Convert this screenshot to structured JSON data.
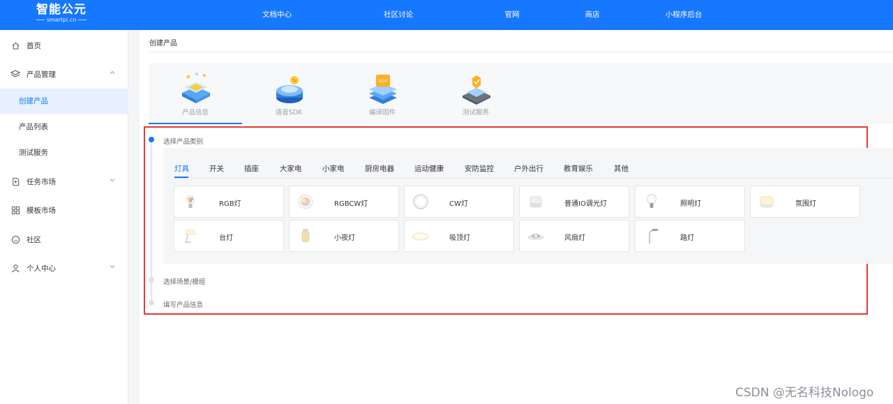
{
  "topbar": {
    "logo": {
      "brand": "智能公元",
      "domain": "smartpi.cn"
    },
    "nav": [
      "文档中心",
      "社区讨论",
      "官网",
      "商店",
      "小程序后台"
    ]
  },
  "sidebar": {
    "items": [
      {
        "label": "首页",
        "icon": "home-icon"
      },
      {
        "label": "产品管理",
        "icon": "layers-icon",
        "expanded": true
      },
      {
        "label": "任务市场",
        "icon": "task-icon"
      },
      {
        "label": "模板市场",
        "icon": "grid-icon"
      },
      {
        "label": "社区",
        "icon": "smile-icon"
      },
      {
        "label": "个人中心",
        "icon": "user-icon"
      }
    ],
    "sub": [
      "创建产品",
      "产品列表",
      "测试服务"
    ]
  },
  "breadcrumb": "创建产品",
  "steps": [
    "产品信息",
    "语音SDK",
    "编译固件",
    "测试服务"
  ],
  "flow": [
    "选择产品类别",
    "选择场景/模组",
    "填写产品信息"
  ],
  "categories": [
    "灯具",
    "开关",
    "插座",
    "大家电",
    "小家电",
    "厨房电器",
    "运动健康",
    "安防监控",
    "户外出行",
    "教育娱乐",
    "其他"
  ],
  "products": [
    "RGB灯",
    "RGBCW灯",
    "CW灯",
    "普通IO调光灯",
    "照明灯",
    "氛围灯",
    "台灯",
    "小夜灯",
    "吸顶灯",
    "风扇灯",
    "路灯"
  ],
  "watermark": "CSDN @无名科技Nologo",
  "colors": {
    "primary": "#1677ff",
    "highlight_box": "#e53935"
  }
}
